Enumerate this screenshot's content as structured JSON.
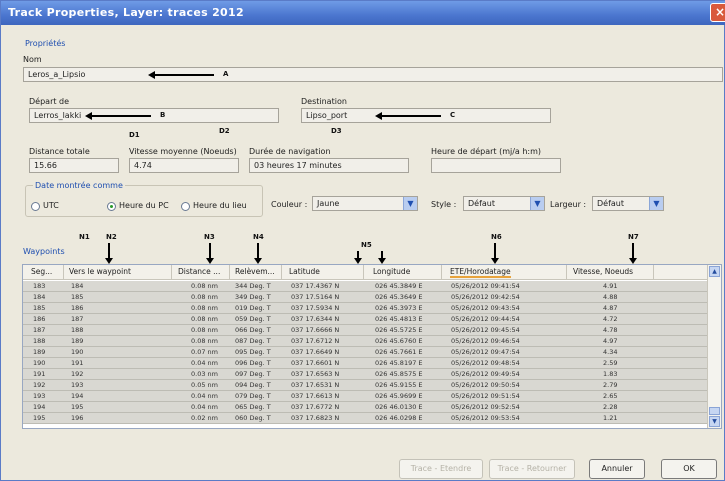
{
  "window": {
    "title": "Track Properties, Layer: traces 2012",
    "close": "×"
  },
  "section": {
    "proprietes": "Propriétés",
    "waypoints": "Waypoints"
  },
  "labels": {
    "nom": "Nom",
    "depart": "Départ de",
    "destination": "Destination",
    "distance": "Distance totale",
    "vitesse": "Vitesse moyenne (Noeuds)",
    "duree": "Durée de navigation",
    "heure_depart": "Heure de départ (mj/a h:m)",
    "date_montree": "Date montrée comme",
    "couleur": "Couleur :",
    "style": "Style :",
    "largeur": "Largeur :"
  },
  "fields": {
    "nom": "Leros_a_Lipsio",
    "depart": "Lerros_lakki",
    "destination": "Lipso_port",
    "distance": "15.66",
    "vitesse": "4.74",
    "duree": "03 heures  17 minutes",
    "heure_depart": ""
  },
  "radios": {
    "utc": "UTC",
    "pc": "Heure du PC",
    "lieu": "Heure du lieu"
  },
  "selects": {
    "couleur": "Jaune",
    "style": "Défaut",
    "largeur": "Défaut",
    "arrow": "▼"
  },
  "annotations": {
    "a": "A",
    "b": "B",
    "c": "C",
    "d1": "D1",
    "d2": "D2",
    "d3": "D3",
    "n1": "N1",
    "n2": "N2",
    "n3": "N3",
    "n4": "N4",
    "n5": "N5",
    "n6": "N6",
    "n7": "N7"
  },
  "table": {
    "headers": [
      "Seg...",
      "Vers le waypoint",
      "Distance ...",
      "Relèvem...",
      "Latitude",
      "Longitude",
      "ETE/Horodatage",
      "Vitesse, Noeuds"
    ],
    "rows": [
      [
        "183",
        "184",
        "0.08 nm",
        "344 Deg. T",
        "037 17.4367 N",
        "026 45.3849 E",
        "05/26/2012 09:41:54",
        "4.91"
      ],
      [
        "184",
        "185",
        "0.08 nm",
        "349 Deg. T",
        "037 17.5164 N",
        "026 45.3649 E",
        "05/26/2012 09:42:54",
        "4.88"
      ],
      [
        "185",
        "186",
        "0.08 nm",
        "019 Deg. T",
        "037 17.5934 N",
        "026 45.3973 E",
        "05/26/2012 09:43:54",
        "4.87"
      ],
      [
        "186",
        "187",
        "0.08 nm",
        "059 Deg. T",
        "037 17.6344 N",
        "026 45.4813 E",
        "05/26/2012 09:44:54",
        "4.72"
      ],
      [
        "187",
        "188",
        "0.08 nm",
        "066 Deg. T",
        "037 17.6666 N",
        "026 45.5725 E",
        "05/26/2012 09:45:54",
        "4.78"
      ],
      [
        "188",
        "189",
        "0.08 nm",
        "087 Deg. T",
        "037 17.6712 N",
        "026 45.6760 E",
        "05/26/2012 09:46:54",
        "4.97"
      ],
      [
        "189",
        "190",
        "0.07 nm",
        "095 Deg. T",
        "037 17.6649 N",
        "026 45.7661 E",
        "05/26/2012 09:47:54",
        "4.34"
      ],
      [
        "190",
        "191",
        "0.04 nm",
        "096 Deg. T",
        "037 17.6601 N",
        "026 45.8197 E",
        "05/26/2012 09:48:54",
        "2.59"
      ],
      [
        "191",
        "192",
        "0.03 nm",
        "097 Deg. T",
        "037 17.6563 N",
        "026 45.8575 E",
        "05/26/2012 09:49:54",
        "1.83"
      ],
      [
        "192",
        "193",
        "0.05 nm",
        "094 Deg. T",
        "037 17.6531 N",
        "026 45.9155 E",
        "05/26/2012 09:50:54",
        "2.79"
      ],
      [
        "193",
        "194",
        "0.04 nm",
        "079 Deg. T",
        "037 17.6613 N",
        "026 45.9699 E",
        "05/26/2012 09:51:54",
        "2.65"
      ],
      [
        "194",
        "195",
        "0.04 nm",
        "065 Deg. T",
        "037 17.6772 N",
        "026 46.0130 E",
        "05/26/2012 09:52:54",
        "2.28"
      ],
      [
        "195",
        "196",
        "0.02 nm",
        "060 Deg. T",
        "037 17.6823 N",
        "026 46.0298 E",
        "05/26/2012 09:53:54",
        "1.21"
      ]
    ]
  },
  "buttons": {
    "trace_etendre": "Trace - Etendre",
    "trace_retourner": "Trace - Retourner",
    "annuler": "Annuler",
    "ok": "OK"
  }
}
